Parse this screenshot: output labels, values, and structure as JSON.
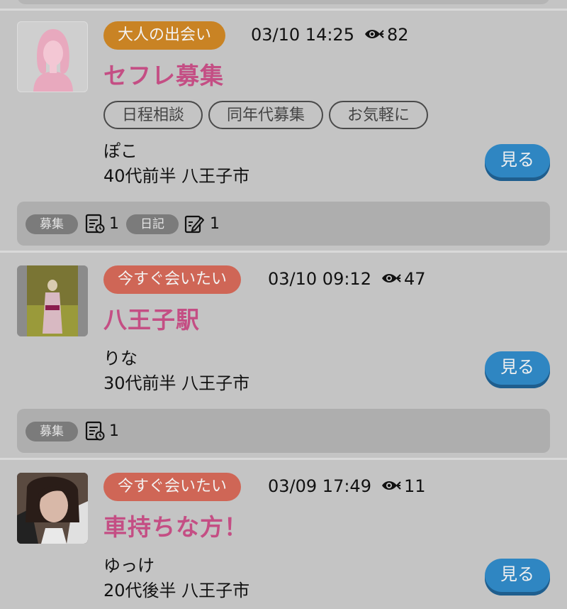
{
  "posts": [
    {
      "category": "大人の出会い",
      "category_color": "#c98324",
      "datetime": "03/10 14:25",
      "views": "82",
      "title": "セフレ募集",
      "tags": [
        "日程相談",
        "同年代募集",
        "お気軽に"
      ],
      "name": "ぽこ",
      "profile": "40代前半 八王子市",
      "view_label": "見る",
      "stats": {
        "recruit_label": "募集",
        "recruit_count": "1",
        "diary_label": "日記",
        "diary_count": "1"
      }
    },
    {
      "category": "今すぐ会いたい",
      "category_color": "#cf6656",
      "datetime": "03/10 09:12",
      "views": "47",
      "title": "八王子駅",
      "name": "りな",
      "profile": "30代前半 八王子市",
      "view_label": "見る",
      "stats": {
        "recruit_label": "募集",
        "recruit_count": "1"
      }
    },
    {
      "category": "今すぐ会いたい",
      "category_color": "#cf6656",
      "datetime": "03/09 17:49",
      "views": "11",
      "title": "車持ちな方！",
      "name": "ゆっけ",
      "profile": "20代後半 八王子市",
      "view_label": "見る"
    }
  ]
}
